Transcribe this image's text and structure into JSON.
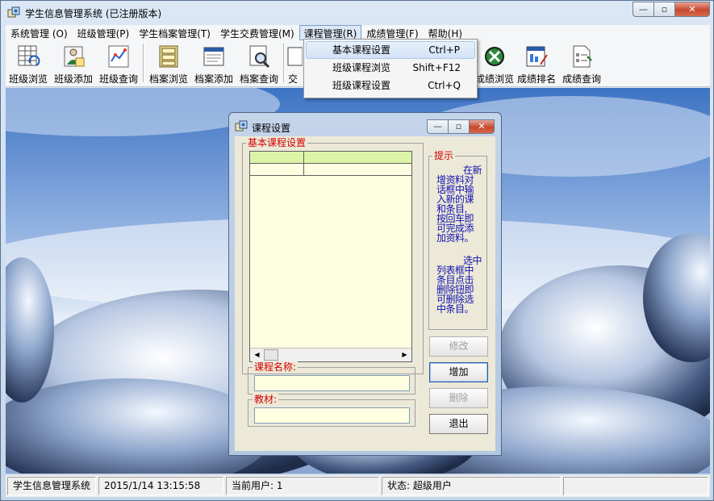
{
  "window": {
    "title": "学生信息管理系统 (已注册版本)"
  },
  "menubar": [
    "系统管理 (O)",
    "班级管理(P)",
    "学生档案管理(T)",
    "学生交费管理(M)",
    "课程管理(R)",
    "成绩管理(F)",
    "帮助(H)"
  ],
  "toolbar": {
    "class_browse": "班级浏览",
    "class_add": "班级添加",
    "class_query": "班级查询",
    "file_browse": "档案浏览",
    "file_add": "档案添加",
    "file_query": "档案查询",
    "fee_partial": "交",
    "score_browse": "成绩浏览",
    "score_rank": "成绩排名",
    "score_query": "成绩查询"
  },
  "dropdown": [
    {
      "label": "基本课程设置",
      "shortcut": "Ctrl+P"
    },
    {
      "label": "班级课程浏览",
      "shortcut": "Shift+F12"
    },
    {
      "label": "班级课程设置",
      "shortcut": "Ctrl+Q"
    }
  ],
  "dialog": {
    "title": "课程设置",
    "group_label": "基本课程设置",
    "hint_label": "提示",
    "hint_lines_1": [
      "在新",
      "增资料对",
      "话框中输",
      "入新的课",
      "和条目,",
      "按回车即",
      "可完成添",
      "加资料。"
    ],
    "hint_lines_2": [
      "选中",
      "列表框中",
      "条目点击",
      "删除钮即",
      "可删除选",
      "中条目。"
    ],
    "course_name_label": "课程名称:",
    "course_name_value": "",
    "textbook_label": "教材:",
    "textbook_value": "",
    "btn_modify": "修改",
    "btn_add": "增加",
    "btn_delete": "删除",
    "btn_exit": "退出"
  },
  "statusbar": {
    "app_name": "学生信息管理系统",
    "datetime": "2015/1/14 13:15:58",
    "current_user": "当前用户: 1",
    "status": "状态:   超级用户"
  }
}
